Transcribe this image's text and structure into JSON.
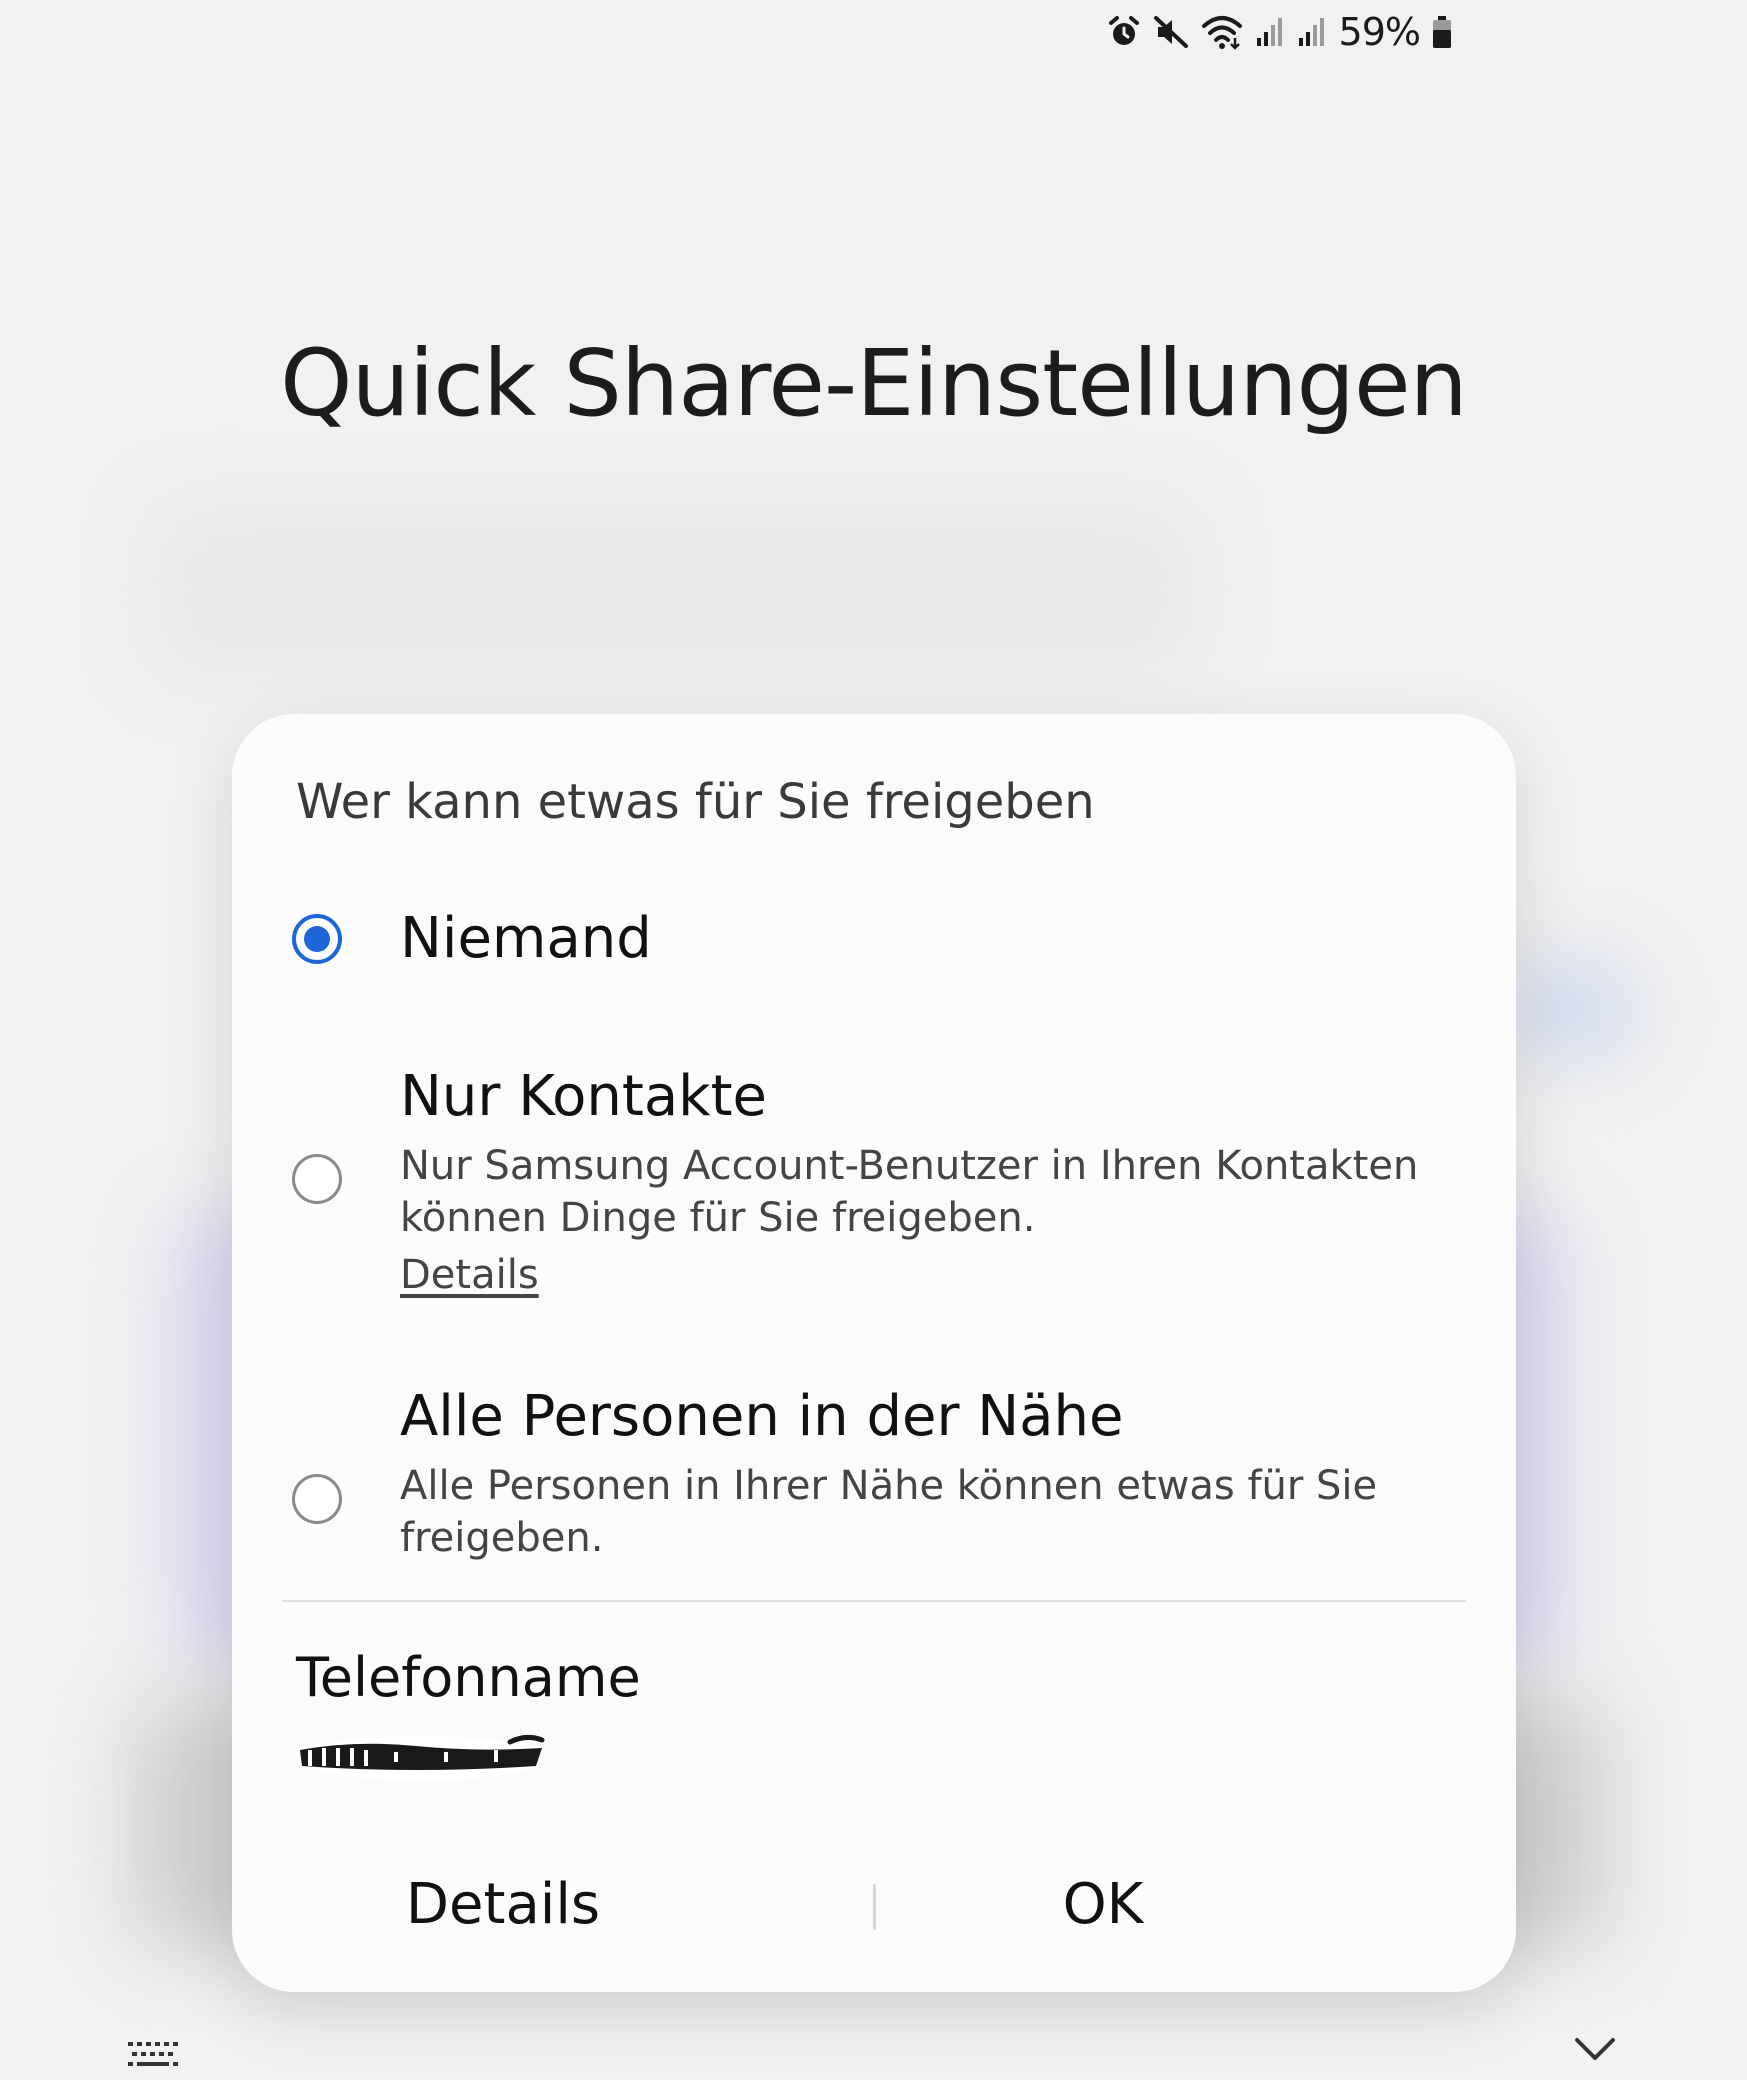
{
  "status_bar": {
    "battery_percent": "59%",
    "icons": [
      "alarm-icon",
      "mute-icon",
      "wifi-icon",
      "signal-icon",
      "signal-icon",
      "battery-icon"
    ]
  },
  "page": {
    "title": "Quick Share-Einstellungen"
  },
  "dialog": {
    "heading": "Wer kann etwas für Sie freigeben",
    "options": [
      {
        "title": "Niemand",
        "selected": true
      },
      {
        "title": "Nur Kontakte",
        "description": "Nur Samsung Account-Benutzer in Ihren Kontakten können Dinge für Sie freigeben.",
        "link": "Details",
        "selected": false
      },
      {
        "title": "Alle Personen in der Nähe",
        "description": "Alle Personen in Ihrer Nähe können etwas für Sie freigeben.",
        "selected": false
      }
    ],
    "phone_name_label": "Telefonname",
    "buttons": {
      "details": "Details",
      "ok": "OK"
    }
  },
  "colors": {
    "accent": "#1c66d8",
    "background": "#f2f1f0",
    "dialog": "#fbfbfc"
  }
}
